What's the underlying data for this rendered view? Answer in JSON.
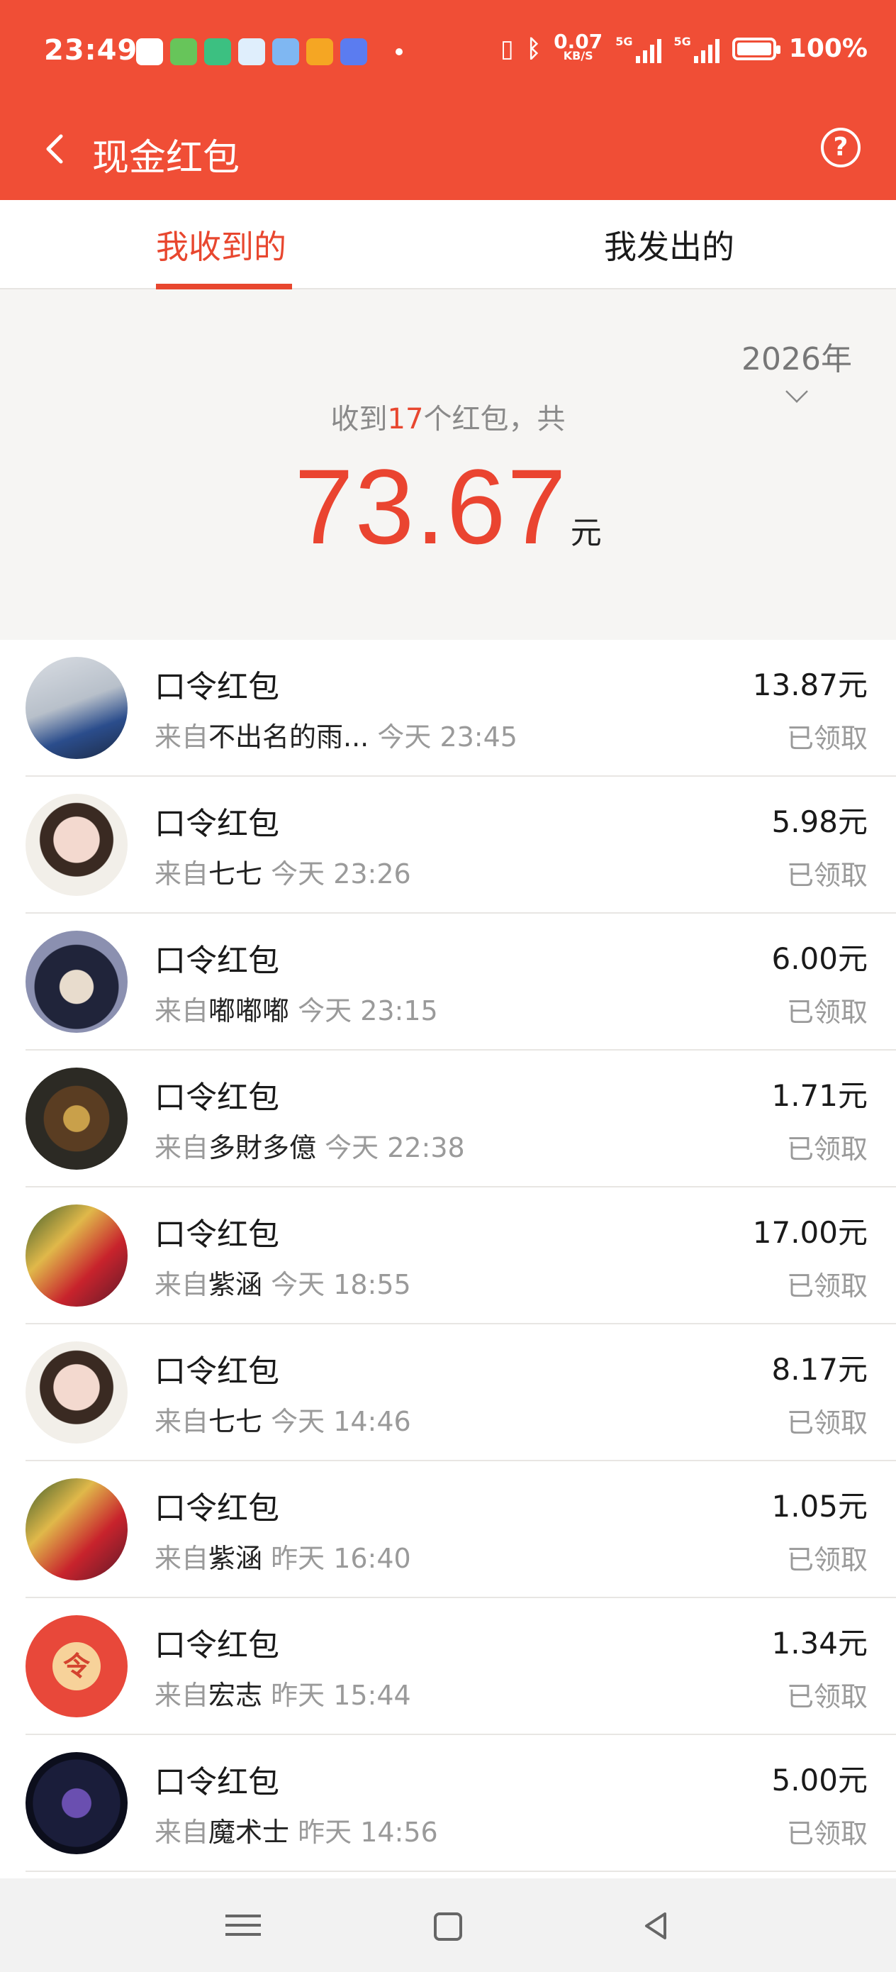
{
  "status_bar": {
    "time": "23:49",
    "net_speed": "0.07",
    "net_unit": "KB/S",
    "signal1": "5G",
    "signal2": "5G",
    "battery": "100%"
  },
  "header": {
    "title": "现金红包",
    "help_icon": "?"
  },
  "tabs": [
    {
      "label": "我收到的",
      "active": true
    },
    {
      "label": "我发出的",
      "active": false
    }
  ],
  "summary": {
    "year": "2026年",
    "prefix": "收到",
    "count": "17",
    "suffix": "个红包，共",
    "total": "73.67",
    "unit": "元"
  },
  "items": [
    {
      "title": "口令红包",
      "from_prefix": "来自",
      "sender": "不出名的雨...",
      "time": "今天 23:45",
      "amount": "13.87元",
      "status": "已领取"
    },
    {
      "title": "口令红包",
      "from_prefix": "来自",
      "sender": "七七",
      "time": "今天 23:26",
      "amount": "5.98元",
      "status": "已领取"
    },
    {
      "title": "口令红包",
      "from_prefix": "来自",
      "sender": "嘟嘟嘟",
      "time": "今天 23:15",
      "amount": "6.00元",
      "status": "已领取"
    },
    {
      "title": "口令红包",
      "from_prefix": "来自",
      "sender": "多財多億",
      "time": "今天 22:38",
      "amount": "1.71元",
      "status": "已领取"
    },
    {
      "title": "口令红包",
      "from_prefix": "来自",
      "sender": "紫涵",
      "time": "今天 18:55",
      "amount": "17.00元",
      "status": "已领取"
    },
    {
      "title": "口令红包",
      "from_prefix": "来自",
      "sender": "七七",
      "time": "今天 14:46",
      "amount": "8.17元",
      "status": "已领取"
    },
    {
      "title": "口令红包",
      "from_prefix": "来自",
      "sender": "紫涵",
      "time": "昨天 16:40",
      "amount": "1.05元",
      "status": "已领取"
    },
    {
      "title": "口令红包",
      "from_prefix": "来自",
      "sender": "宏志",
      "time": "昨天 15:44",
      "amount": "1.34元",
      "status": "已领取",
      "avatar_glyph": "令"
    },
    {
      "title": "口令红包",
      "from_prefix": "来自",
      "sender": "魔术士",
      "time": "昨天 14:56",
      "amount": "5.00元",
      "status": "已领取"
    }
  ],
  "colors": {
    "header_bg": "#f04e36",
    "accent": "#e8472f",
    "total_amount": "#ea4430"
  }
}
